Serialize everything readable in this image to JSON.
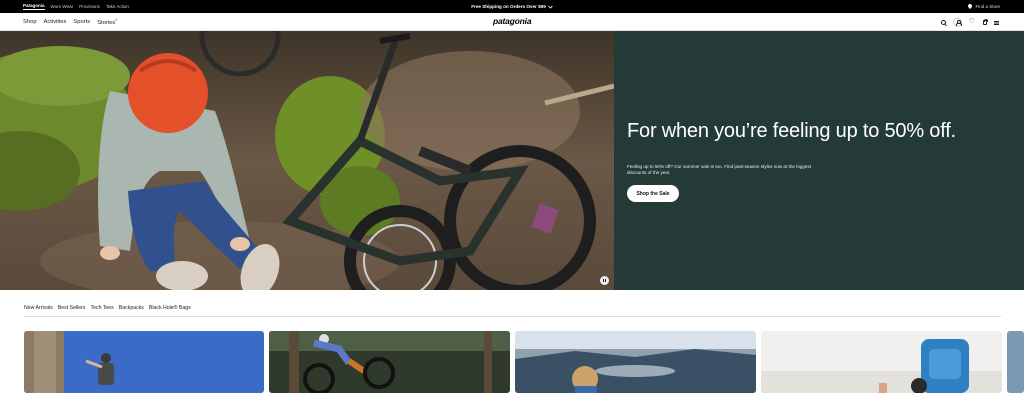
{
  "utility": {
    "brands": [
      "Patagonia",
      "Worn Wear",
      "Provisions",
      "Take Action"
    ],
    "active_brand_index": 0,
    "promo": "Free Shipping on Orders Over $99",
    "promo_chevron": "chevron-down-icon",
    "store_label": "Find a Store",
    "store_icon": "location-pin-icon"
  },
  "nav": {
    "links": [
      "Shop",
      "Activities",
      "Sports",
      "Stories"
    ],
    "stories_badge": "®",
    "logo": "patagonia",
    "icons": [
      "search-icon",
      "account-icon",
      "wishlist-heart-icon",
      "bag-icon",
      "menu-icon"
    ]
  },
  "hero": {
    "headline": "For when you’re feeling up to 50% off.",
    "body": "Feeling up to 50% off? Our summer sale is too. Find past-season styles now at the biggest discounts of the year.",
    "cta": "Shop the Sale",
    "panel_color": "#243a36",
    "pause_icon": "pause-icon",
    "image_alt": "Child in orange helmet sitting on dirt trail next to a fallen mountain bike"
  },
  "category_tabs": [
    "New Arrivals",
    "Best Sellers",
    "Tech Tees",
    "Backpacks",
    "Black Hole® Bags"
  ],
  "product_cards": [
    {
      "scene": "climber on rock against blue sky"
    },
    {
      "scene": "mountain biker in forest"
    },
    {
      "scene": "child with lake and misty hills"
    },
    {
      "scene": "hiker with blue backpack"
    },
    {
      "scene": "partial card at edge"
    }
  ]
}
